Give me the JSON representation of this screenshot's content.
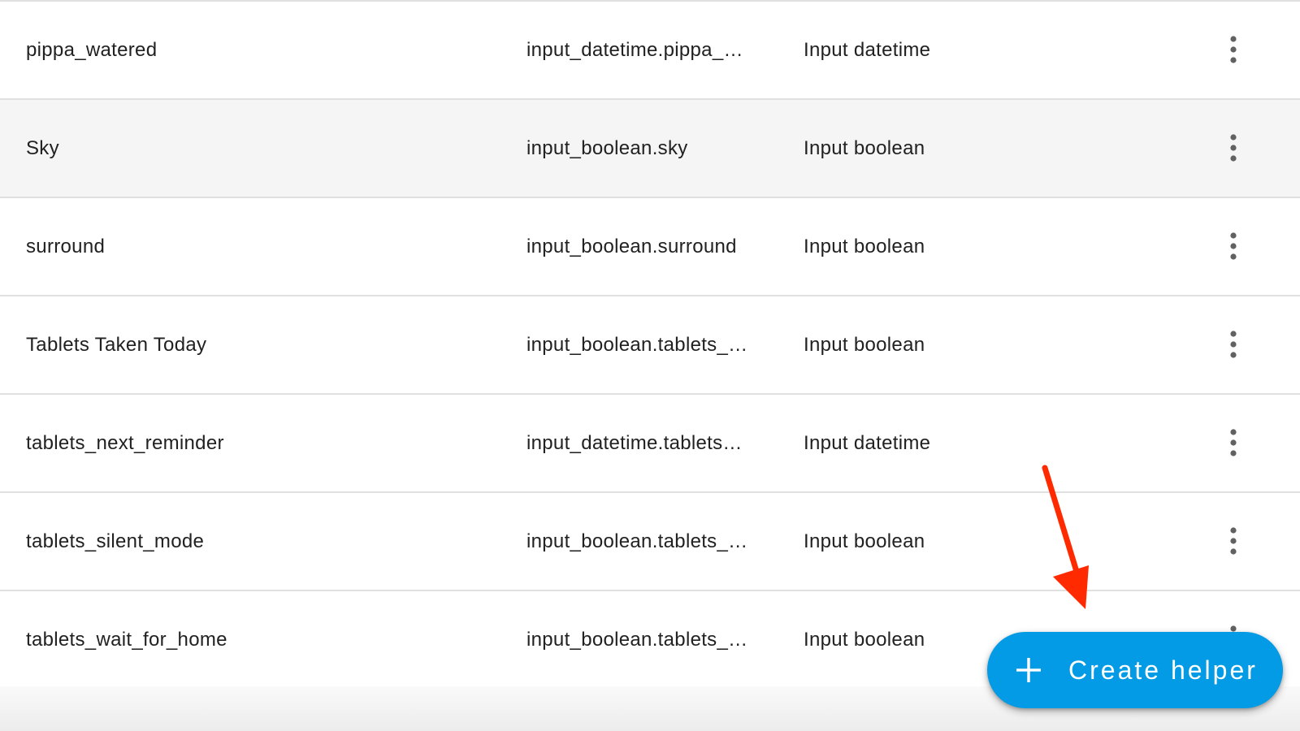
{
  "helpers": {
    "rows": [
      {
        "name": "pippa_watered",
        "entity_id": "input_datetime.pippa_…",
        "type": "Input datetime"
      },
      {
        "name": "Sky",
        "entity_id": "input_boolean.sky",
        "type": "Input boolean"
      },
      {
        "name": "surround",
        "entity_id": "input_boolean.surround",
        "type": "Input boolean"
      },
      {
        "name": "Tablets Taken Today",
        "entity_id": "input_boolean.tablets_t…",
        "type": "Input boolean"
      },
      {
        "name": "tablets_next_reminder",
        "entity_id": "input_datetime.tablets_…",
        "type": "Input datetime"
      },
      {
        "name": "tablets_silent_mode",
        "entity_id": "input_boolean.tablets_…",
        "type": "Input boolean"
      },
      {
        "name": "tablets_wait_for_home",
        "entity_id": "input_boolean.tablets_…",
        "type": "Input boolean"
      }
    ],
    "row_menu_icon": "dots-vertical-icon",
    "hovered_row": 1
  },
  "fab": {
    "label": "Create helper",
    "icon": "plus-icon",
    "color": "#039be5"
  },
  "annotation": {
    "icon": "red-arrow-pointer",
    "color": "#ff2a00"
  }
}
